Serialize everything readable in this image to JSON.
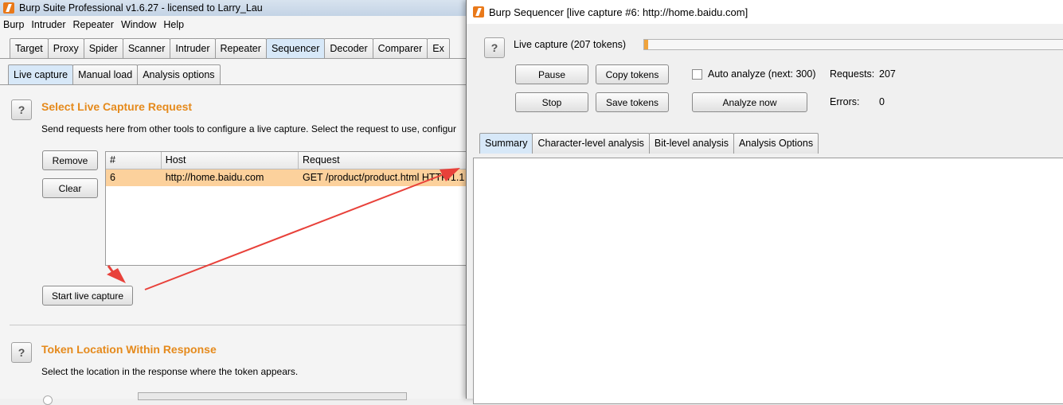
{
  "main": {
    "title": "Burp Suite Professional v1.6.27 - licensed to Larry_Lau",
    "menu": [
      "Burp",
      "Intruder",
      "Repeater",
      "Window",
      "Help"
    ],
    "tabs": [
      "Target",
      "Proxy",
      "Spider",
      "Scanner",
      "Intruder",
      "Repeater",
      "Sequencer",
      "Decoder",
      "Comparer",
      "Ex"
    ],
    "subtabs": [
      "Live capture",
      "Manual load",
      "Analysis options"
    ],
    "select_section": {
      "title": "Select Live Capture Request",
      "description": "Send requests here from other tools to configure a live capture. Select the request to use, configur",
      "remove_label": "Remove",
      "clear_label": "Clear",
      "columns": [
        "#",
        "Host",
        "Request"
      ],
      "rows": [
        {
          "num": "6",
          "host": "http://home.baidu.com",
          "request": "GET /product/product.html HTTP/1.1"
        }
      ],
      "start_label": "Start live capture"
    },
    "token_section": {
      "title": "Token Location Within Response",
      "description": "Select the location in the response where the token appears."
    },
    "help_glyph": "?"
  },
  "sequencer": {
    "title": "Burp Sequencer [live capture #6: http://home.baidu.com]",
    "capture_label": "Live capture (207 tokens)",
    "progress": 0.01,
    "pause_label": "Pause",
    "copy_label": "Copy tokens",
    "stop_label": "Stop",
    "save_label": "Save tokens",
    "auto_label": "Auto analyze (next: 300)",
    "analyze_label": "Analyze now",
    "requests_label": "Requests:",
    "requests_value": "207",
    "errors_label": "Errors:",
    "errors_value": "0",
    "tabs": [
      "Summary",
      "Character-level analysis",
      "Bit-level analysis",
      "Analysis Options"
    ]
  },
  "colors": {
    "accent_orange": "#e58a1c",
    "selected_row": "#fcd19c",
    "arrow_red": "#e8413a"
  },
  "icons": [
    "burp-logo-icon",
    "help-icon",
    "checkbox-icon",
    "red-arrow-annotation"
  ]
}
